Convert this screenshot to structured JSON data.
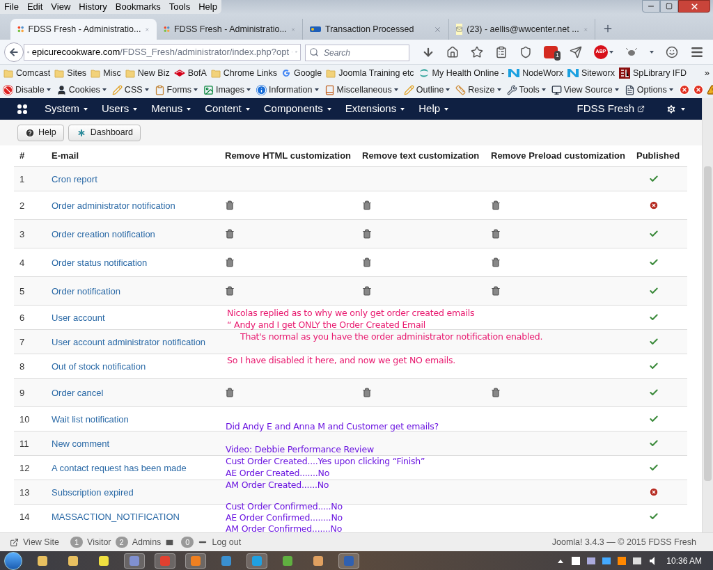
{
  "menu_bar": [
    "File",
    "Edit",
    "View",
    "History",
    "Bookmarks",
    "Tools",
    "Help"
  ],
  "tabs": [
    {
      "title": "FDSS Fresh - Administratio...",
      "kind": "joomla",
      "selected": true
    },
    {
      "title": "FDSS Fresh - Administratio...",
      "kind": "joomla",
      "selected": false
    },
    {
      "title": "Transaction Processed",
      "kind": "epn",
      "selected": false
    },
    {
      "title": "(23) - aellis@wwcenter.net ...",
      "kind": "mail",
      "selected": false
    }
  ],
  "address": {
    "domain": "epicurecookware.com",
    "path": "/FDSS_Fresh/administrator/index.php?opt"
  },
  "search": {
    "placeholder": "Search"
  },
  "toolbar_badge": "1",
  "adblock_label": "ABP",
  "bookmarks": [
    {
      "label": "Comcast",
      "kind": "folder"
    },
    {
      "label": "Sites",
      "kind": "folder"
    },
    {
      "label": "Misc",
      "kind": "folder"
    },
    {
      "label": "New Biz",
      "kind": "folder"
    },
    {
      "label": "BofA",
      "kind": "flag"
    },
    {
      "label": "Chrome Links",
      "kind": "folder"
    },
    {
      "label": "Google",
      "kind": "google"
    },
    {
      "label": "Joomla Training etc",
      "kind": "folder"
    },
    {
      "label": "My Health Online -",
      "kind": "health"
    },
    {
      "label": "NodeWorx",
      "kind": "nodeworx"
    },
    {
      "label": "Siteworx",
      "kind": "nodeworx"
    },
    {
      "label": "SpLibrary IFD",
      "kind": "sl"
    }
  ],
  "bookmarks_overflow": "»",
  "devtools": [
    {
      "label": "Disable",
      "kind": "ban"
    },
    {
      "label": "Cookies",
      "kind": "user"
    },
    {
      "label": "CSS",
      "kind": "pencil"
    },
    {
      "label": "Forms",
      "kind": "clipboard"
    },
    {
      "label": "Images",
      "kind": "image"
    },
    {
      "label": "Information",
      "kind": "info"
    },
    {
      "label": "Miscellaneous",
      "kind": "book"
    },
    {
      "label": "Outline",
      "kind": "pencil"
    },
    {
      "label": "Resize",
      "kind": "ruler"
    },
    {
      "label": "Tools",
      "kind": "wrench"
    },
    {
      "label": "View Source",
      "kind": "monitor"
    },
    {
      "label": "Options",
      "kind": "doc"
    }
  ],
  "admin_menu": [
    "System",
    "Users",
    "Menus",
    "Content",
    "Components",
    "Extensions",
    "Help"
  ],
  "site_link": "FDSS Fresh",
  "buttons": [
    {
      "label": "Help",
      "kind": "help"
    },
    {
      "label": "Dashboard",
      "kind": "dashboard"
    }
  ],
  "table": {
    "columns": [
      "#",
      "E-mail",
      "Remove HTML customization",
      "Remove text customization",
      "Remove Preload customization",
      "Published"
    ],
    "rows": [
      {
        "number": "1",
        "email": "Cron report",
        "html": false,
        "text": false,
        "preload": false,
        "published": true
      },
      {
        "number": "2",
        "email": "Order administrator notification",
        "html": true,
        "text": true,
        "preload": true,
        "published": false
      },
      {
        "number": "3",
        "email": "Order creation notification",
        "html": true,
        "text": true,
        "preload": true,
        "published": true
      },
      {
        "number": "4",
        "email": "Order status notification",
        "html": true,
        "text": true,
        "preload": true,
        "published": true
      },
      {
        "number": "5",
        "email": "Order notification",
        "html": true,
        "text": true,
        "preload": true,
        "published": true
      },
      {
        "number": "6",
        "email": "User account",
        "html": false,
        "text": false,
        "preload": false,
        "published": true
      },
      {
        "number": "7",
        "email": "User account administrator notification",
        "html": false,
        "text": false,
        "preload": false,
        "published": true
      },
      {
        "number": "8",
        "email": "Out of stock notification",
        "html": false,
        "text": false,
        "preload": false,
        "published": true
      },
      {
        "number": "9",
        "email": "Order cancel",
        "html": true,
        "text": true,
        "preload": true,
        "published": true
      },
      {
        "number": "10",
        "email": "Wait list notification",
        "html": false,
        "text": false,
        "preload": false,
        "published": true
      },
      {
        "number": "11",
        "email": "New comment",
        "html": false,
        "text": false,
        "preload": false,
        "published": true
      },
      {
        "number": "12",
        "email": "A contact request has been made",
        "html": false,
        "text": false,
        "preload": false,
        "published": true
      },
      {
        "number": "13",
        "email": "Subscription expired",
        "html": false,
        "text": false,
        "preload": false,
        "published": false
      },
      {
        "number": "14",
        "email": "MASSACTION_NOTIFICATION",
        "html": false,
        "text": false,
        "preload": false,
        "published": true
      }
    ]
  },
  "annotations": [
    {
      "text": "Nicolas replied as to why we only get order created emails",
      "color": "#e8186e"
    },
    {
      "text": "“ Andy and I get ONLY the Order Created Email",
      "color": "#e8186e"
    },
    {
      "text": "That's normal as you have the order administrator notification enabled.",
      "color": "#e8186e"
    },
    {
      "text": "So I have disabled it here, and now we get NO emails.",
      "color": "#e8186e"
    },
    {
      "text": "Did Andy E and Anna M and Customer get emails?",
      "color": "#6a14e0"
    },
    {
      "text": "Video: Debbie Performance Review",
      "color": "#6a14e0"
    },
    {
      "text": "Cust Order Created....Yes upon clicking “Finish”",
      "color": "#6a14e0"
    },
    {
      "text": "AE Order Created.......No",
      "color": "#6a14e0"
    },
    {
      "text": "AM Order Created......No",
      "color": "#6a14e0"
    },
    {
      "text": "Cust Order Confirmed.....No",
      "color": "#6a14e0"
    },
    {
      "text": "AE Order Confirmed........No",
      "color": "#6a14e0"
    },
    {
      "text": "AM Order Confirmed.......No",
      "color": "#6a14e0"
    }
  ],
  "status_bar": {
    "view_site": "View Site",
    "visitors": {
      "count": "1",
      "label": "Visitor"
    },
    "admins": {
      "count": "2",
      "label": "Admins"
    },
    "messages": "0",
    "logout": "Log out",
    "version": "Joomla! 3.4.3 — © 2015 FDSS Fresh"
  },
  "clock": "10:36 AM"
}
